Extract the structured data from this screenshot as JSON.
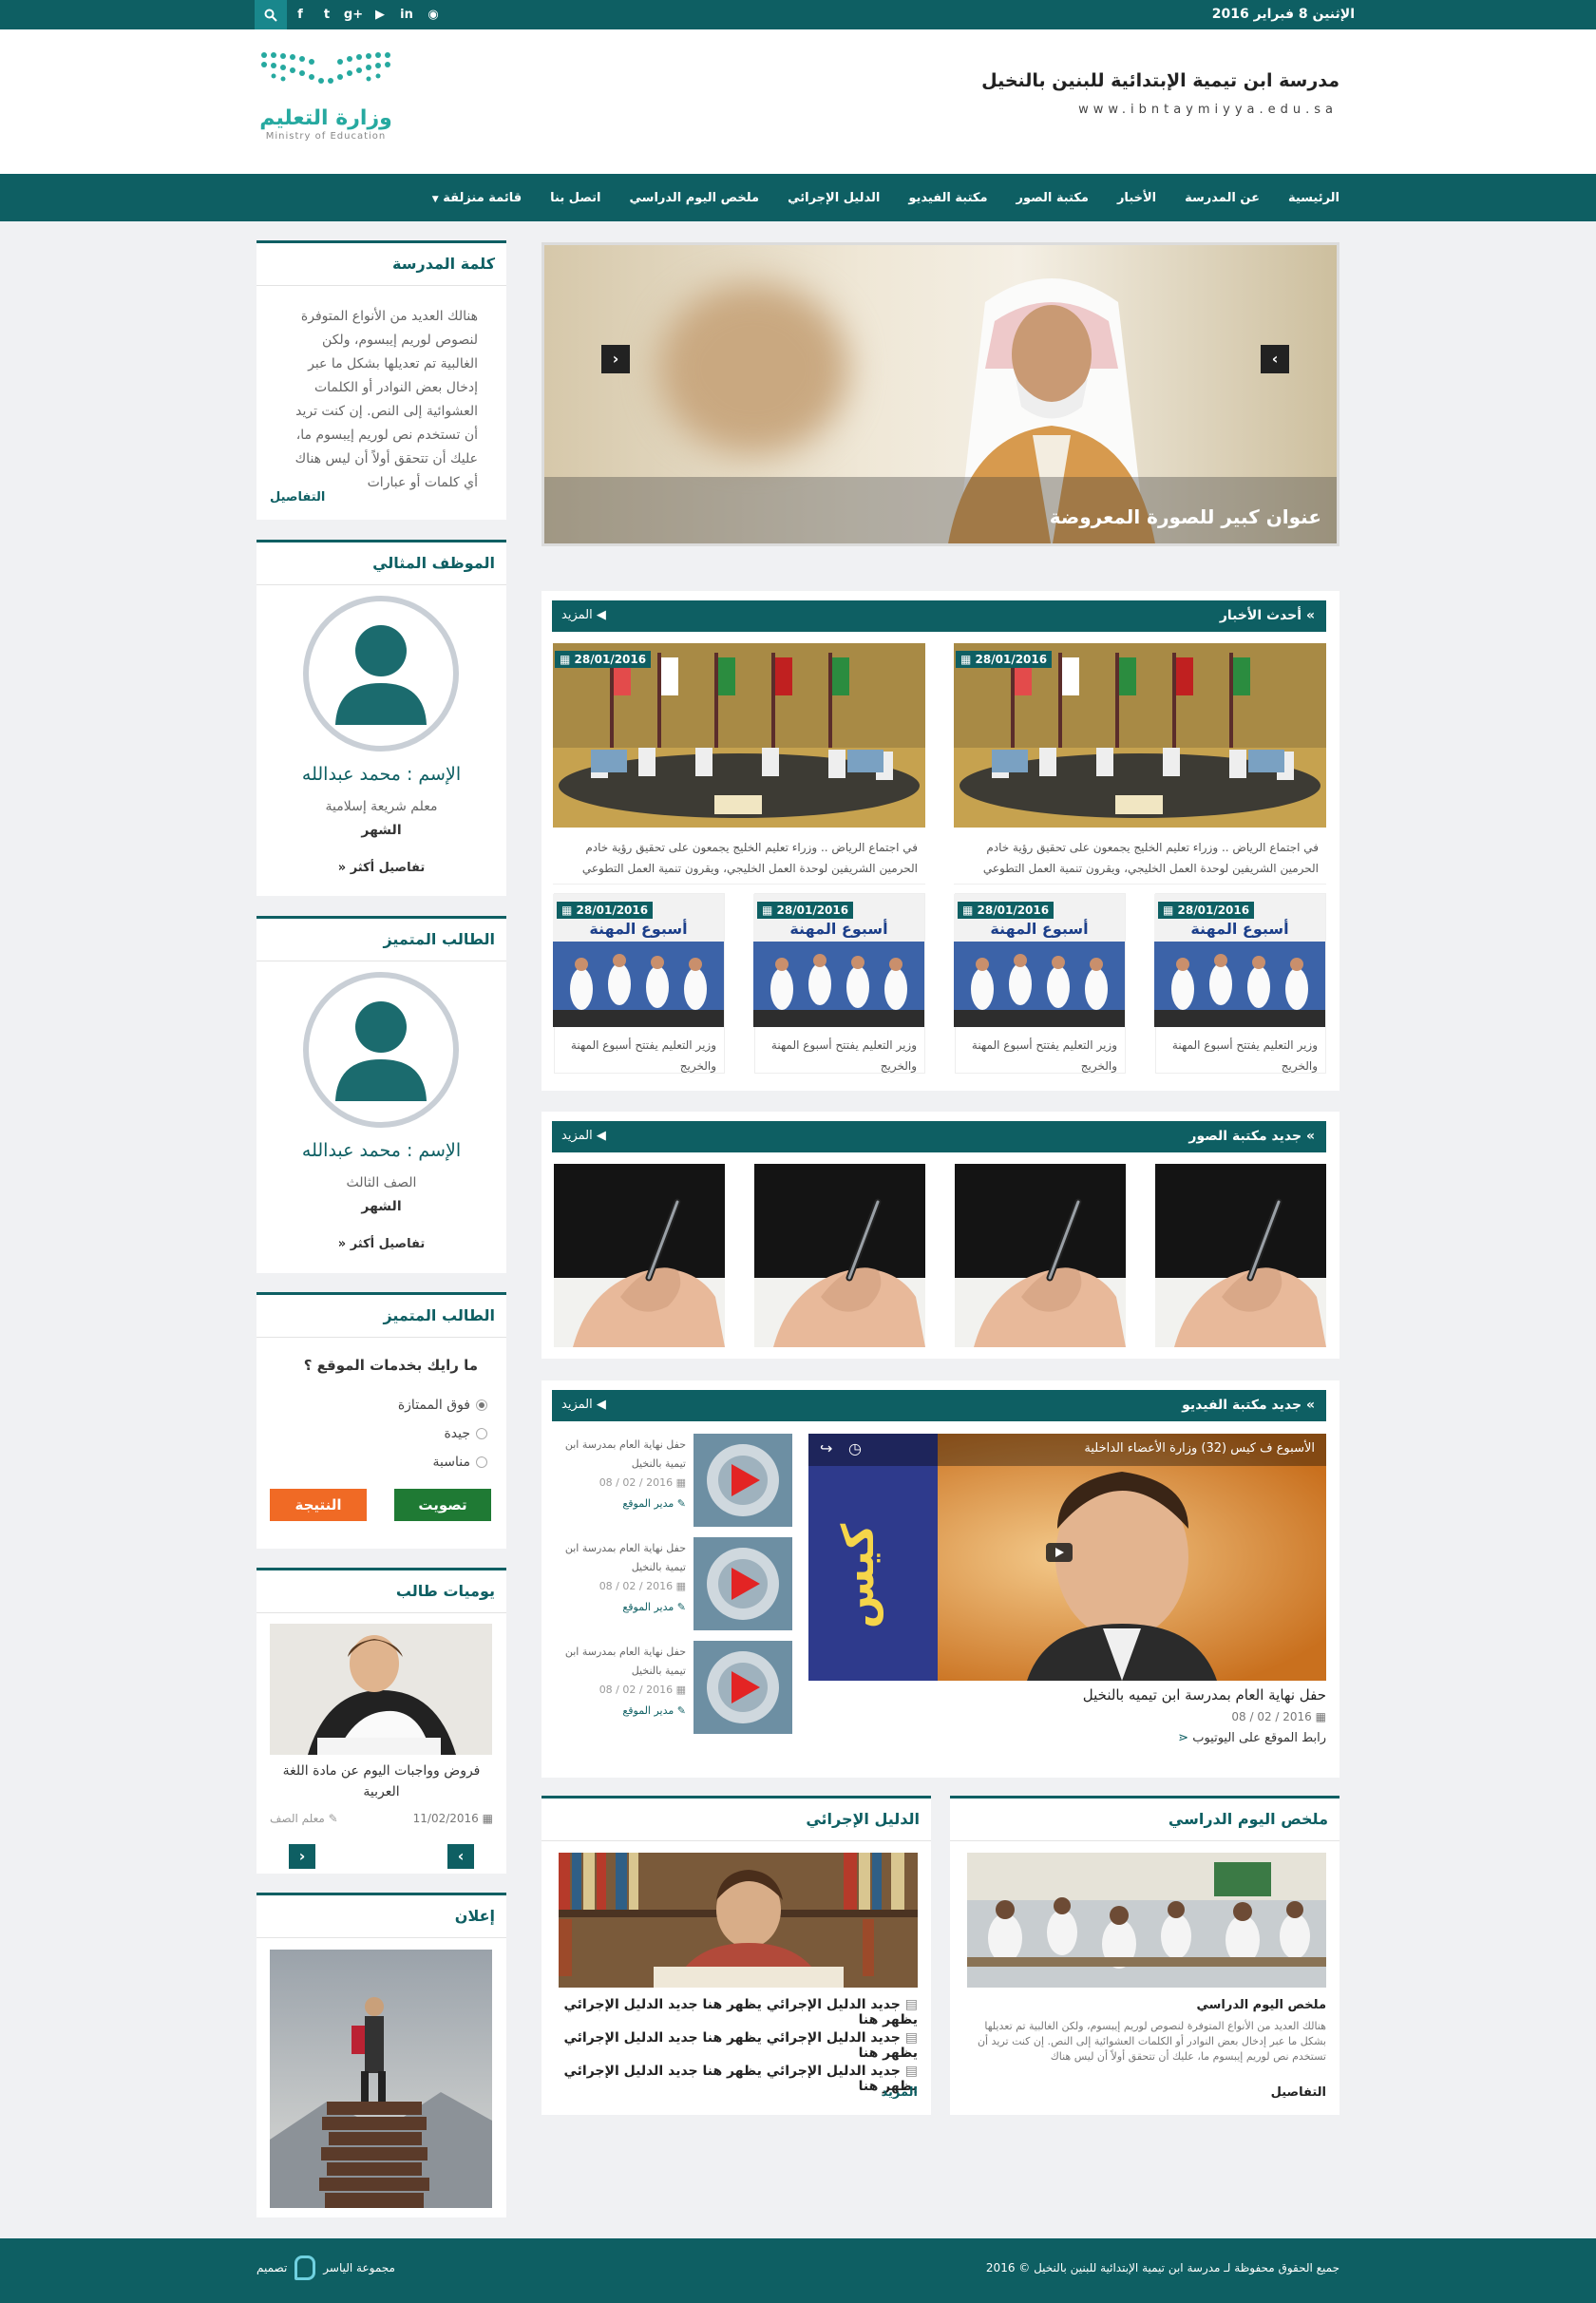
{
  "topbar": {
    "date": "الإثنين 8 فبراير 2016",
    "social": [
      "search-icon",
      "facebook-icon",
      "twitter-icon",
      "google-plus-icon",
      "youtube-icon",
      "linkedin-icon",
      "rss-icon"
    ]
  },
  "header": {
    "school_name": "مدرسة ابن تيمية الإبتدائية للبنين بالنخيل",
    "school_url": "www.ibntaymiyya.edu.sa",
    "ministry_ar": "وزارة التعليم",
    "ministry_en": "Ministry of Education"
  },
  "nav": [
    "الرئيسية",
    "عن المدرسة",
    "الأخبار",
    "مكتبة الصور",
    "مكتبة الفيديو",
    "الدليل الإجرائي",
    "ملخص اليوم الدراسي",
    "اتصل بنا",
    "قائمة منزلقة"
  ],
  "slider": {
    "caption": "عنوان كبير للصورة المعروضة"
  },
  "sidebar": {
    "school_word": {
      "title": "كلمة المدرسة",
      "text": "هنالك العديد من الأنواع المتوفرة لنصوص لوريم إيبسوم، ولكن الغالبية تم تعديلها بشكل ما عبر إدخال بعض النوادر أو الكلمات العشوائية إلى النص. إن كنت تريد أن تستخدم نص لوريم إيبسوم ما، عليك أن تتحقق أولاً أن ليس هناك أي كلمات أو عبارات",
      "more": "التفاصيل"
    },
    "employee": {
      "title": "الموظف المثالي",
      "name": "الإسم : محمد عبدالله",
      "role": "معلم شريعة إسلامية",
      "period": "الشهر",
      "more": "تفاصيل أكثر"
    },
    "student": {
      "title": "الطالب المتميز",
      "name": "الإسم : محمد عبدالله",
      "role": "الصف الثالث",
      "period": "الشهر",
      "more": "تفاصيل أكثر"
    },
    "poll": {
      "title": "الطالب المتميز",
      "question": "ما رايك بخدمات الموقع ؟",
      "options": [
        "فوق الممتازة",
        "جيدة",
        "مناسبة"
      ],
      "vote": "تصويت",
      "result": "النتيجة"
    },
    "diary": {
      "title": "يوميات طالب",
      "caption": "فروض وواجبات اليوم عن مادة اللغة العربية",
      "date": "11/02/2016",
      "author": "معلم الصف"
    },
    "ad": {
      "title": "إعلان"
    }
  },
  "news": {
    "title": "أحدث الأخبار",
    "more": "المزيد",
    "big": [
      {
        "date": "28/01/2016",
        "text": "في اجتماع الرياض .. وزراء تعليم الخليج يجمعون على تحقيق رؤية خادم الحرمين الشريفين لوحدة العمل الخليجي، ويقرون تنمية العمل التطوعي"
      },
      {
        "date": "28/01/2016",
        "text": "في اجتماع الرياض .. وزراء تعليم الخليج يجمعون على تحقيق رؤية خادم الحرمين الشريفين لوحدة العمل الخليجي، ويقرون تنمية العمل التطوعي"
      }
    ],
    "small": [
      {
        "date": "28/01/2016",
        "text": "وزير التعليم يفتتح أسبوع المهنة والخريج"
      },
      {
        "date": "28/01/2016",
        "text": "وزير التعليم يفتتح أسبوع المهنة والخريج"
      },
      {
        "date": "28/01/2016",
        "text": "وزير التعليم يفتتح أسبوع المهنة والخريج"
      },
      {
        "date": "28/01/2016",
        "text": "وزير التعليم يفتتح أسبوع المهنة والخريج"
      }
    ],
    "poster_title": "أسبوع المهنة"
  },
  "photos": {
    "title": "جديد مكتبة الصور",
    "more": "المزيد"
  },
  "videos": {
    "title": "جديد مكتبة الفيديو",
    "more": "المزيد",
    "main": {
      "overlay": "الأسبوع ف كيس (32) وزارة الأعضاء الداخلية",
      "title": "حفل نهاية العام بمدرسة ابن تيميه بالنخيل",
      "date": "2016 / 02 / 08",
      "youtube": "رابط الموقع على اليوتيوب"
    },
    "list": [
      {
        "title": "حفل نهاية العام بمدرسة ابن تيمية بالنخيل",
        "date": "2016 / 02 / 08",
        "author": "مدير الموقع"
      },
      {
        "title": "حفل نهاية العام بمدرسة ابن تيمية بالنخيل",
        "date": "2016 / 02 / 08",
        "author": "مدير الموقع"
      },
      {
        "title": "حفل نهاية العام بمدرسة ابن تيمية بالنخيل",
        "date": "2016 / 02 / 08",
        "author": "مدير الموقع"
      }
    ]
  },
  "summary": {
    "title": "ملخص اليوم الدراسي",
    "heading": "ملخص اليوم الدراسي",
    "text": "هنالك العديد من الأنواع المتوفرة لنصوص لوريم إيبسوم، ولكن الغالبية تم تعديلها بشكل ما عبر إدخال بعض النوادر أو الكلمات العشوائية إلى النص. إن كنت تريد أن تستخدم نص لوريم إيبسوم ما، عليك أن تتحقق أولاً أن ليس هناك",
    "more": "التفاصيل"
  },
  "guide": {
    "title": "الدليل الإجرائي",
    "links": [
      "جديد الدليل الإجرائي يظهر هنا جديد الدليل الإجرائي يظهر هنا",
      "جديد الدليل الإجرائي يظهر هنا جديد الدليل الإجرائي يظهر هنا",
      "جديد الدليل الإجرائي يظهر هنا جديد الدليل الإجرائي يظهر هنا"
    ],
    "more": "المزيد"
  },
  "footer": {
    "copyright": "جميع الحقوق محفوظة لـ مدرسة ابن تيمية الإبتدائية للبنين بالنخيل © 2016",
    "design_label": "تصميم",
    "designer": "مجموعة الياسر"
  },
  "colors": {
    "primary": "#0e5f63",
    "vote": "#1f7a34",
    "result": "#f06a25"
  }
}
